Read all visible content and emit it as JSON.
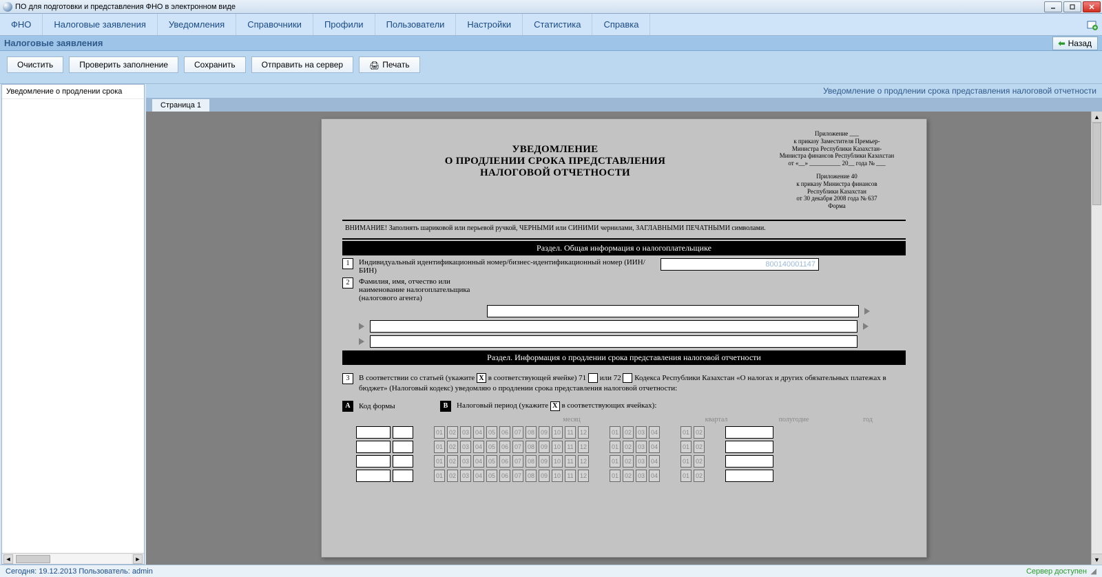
{
  "titlebar": {
    "title": "ПО для подготовки и представления ФНО в электронном виде"
  },
  "menu": {
    "items": [
      "ФНО",
      "Налоговые заявления",
      "Уведомления",
      "Справочники",
      "Профили",
      "Пользователи",
      "Настройки",
      "Статистика",
      "Справка"
    ]
  },
  "subheader": {
    "crumb": "Налоговые заявления",
    "back": "Назад"
  },
  "toolbar": {
    "clear": "Очистить",
    "check": "Проверить заполнение",
    "save": "Сохранить",
    "send": "Отправить на сервер",
    "print": "Печать"
  },
  "tree": {
    "item1": "Уведомление о продлении срока"
  },
  "doc_title": "Уведомление о продлении срока представления налоговой отчетности",
  "tab1": "Страница 1",
  "form": {
    "title1": "УВЕДОМЛЕНИЕ",
    "title2": "О ПРОДЛЕНИИ СРОКА ПРЕДСТАВЛЕНИЯ",
    "title3": "НАЛОГОВОЙ ОТЧЕТНОСТИ",
    "annex1_l1": "Приложение ___",
    "annex1_l2": "к приказу Заместителя Премьер-",
    "annex1_l3": "Министра Республики Казахстан-",
    "annex1_l4": "Министра финансов Республики Казахстан",
    "annex1_l5": "от «__» __________ 20__ года № ___",
    "annex2_l1": "Приложение 40",
    "annex2_l2": "к приказу Министра финансов",
    "annex2_l3": "Республики Казахстан",
    "annex2_l4": "от 30 декабря 2008 года № 637",
    "annex2_l5": "Форма",
    "warning": "ВНИМАНИЕ! Заполнять шариковой или перьевой ручкой, ЧЕРНЫМИ или СИНИМИ чернилами, ЗАГЛАВНЫМИ ПЕЧАТНЫМИ символами.",
    "section1": "Раздел. Общая информация о налогоплательщике",
    "section2": "Раздел. Информация о продлении срока представления налоговой отчетности",
    "f1_num": "1",
    "f1_label": "Индивидуальный идентификационный номер/бизнес-идентификационный номер (ИИН/БИН)",
    "f1_value": "800140001147",
    "f2_num": "2",
    "f2_label": "Фамилия, имя, отчество или наименование налогоплательщика (налогового агента)",
    "f3_num": "3",
    "f3_p1": "В соответствии со статьей (укажите ",
    "f3_x": "X",
    "f3_p2": " в соответствующей ячейке) 71 ",
    "f3_p3": " или 72 ",
    "f3_p4": " Кодекса Республики Казахстан «О налогах и других обязательных платежах в бюджет» (Налоговый кодекс) уведомляю о продлении срока представления налоговой отчетности:",
    "fA": "А",
    "fA_label": "Код формы",
    "fB": "В",
    "fB_label": "Налоговый период   (укажите ",
    "fB_p2": " в соответствующих ячейках):",
    "ph_month": "месяц",
    "ph_quarter": "квартал",
    "ph_half": "полугодие",
    "ph_year": "год",
    "months": [
      "01",
      "02",
      "03",
      "04",
      "05",
      "06",
      "07",
      "08",
      "09",
      "10",
      "11",
      "12"
    ],
    "quarters": [
      "01",
      "02",
      "03",
      "04"
    ],
    "halves": [
      "01",
      "02"
    ]
  },
  "status": {
    "left": "Сегодня: 19.12.2013  Пользователь: admin",
    "right": "Сервер доступен"
  }
}
